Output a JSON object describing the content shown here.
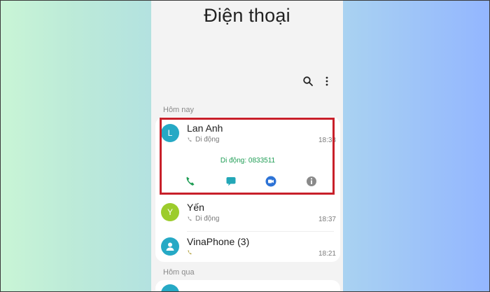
{
  "app": {
    "title": "Điện thoại"
  },
  "toolbar": {
    "search_icon": "search-icon",
    "more_icon": "more-vertical-icon"
  },
  "sections": {
    "today": {
      "label": "Hôm nay"
    },
    "yesterday": {
      "label": "Hôm qua"
    }
  },
  "calls": [
    {
      "name": "Lan Anh",
      "avatar_letter": "L",
      "avatar_color": "#26a9c5",
      "type": "Di động",
      "time": "18:38",
      "expanded_number": "Di động: 0833511"
    },
    {
      "name": "Yến",
      "avatar_letter": "Y",
      "avatar_color": "#9ccc2c",
      "type": "Di động",
      "time": "18:37"
    },
    {
      "name": "VinaPhone (3)",
      "avatar_letter": "",
      "avatar_color": "#26a9c5",
      "type": "",
      "time": "18:21"
    }
  ],
  "actions": [
    "call-icon",
    "message-icon",
    "video-call-icon",
    "info-icon"
  ],
  "colors": {
    "highlight": "#c8202a",
    "call_green": "#1f9d55",
    "message_teal": "#23a7b7",
    "video_blue": "#2d73d6",
    "info_gray": "#8a8a8a"
  }
}
